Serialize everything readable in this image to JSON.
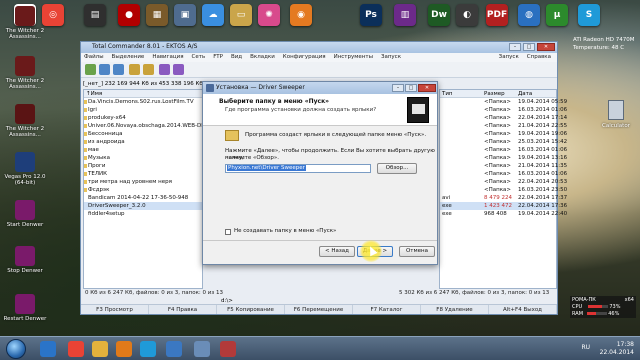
{
  "dock": {
    "icons": [
      {
        "name": "vlc-icon",
        "glyph": "▲",
        "color": "#ffffff"
      },
      {
        "name": "chrome-icon",
        "glyph": "◎",
        "color": "#e94335"
      },
      {
        "name": "film-icon",
        "glyph": "▤",
        "color": "#2f2f2f"
      },
      {
        "name": "record-icon",
        "glyph": "●",
        "color": "#b20000"
      },
      {
        "name": "archive-icon",
        "glyph": "▦",
        "color": "#7a5a2a"
      },
      {
        "name": "photos-icon",
        "glyph": "▣",
        "color": "#4f6c8f"
      },
      {
        "name": "cloud-icon",
        "glyph": "☁",
        "color": "#3a8fe0"
      },
      {
        "name": "folder-icon",
        "glyph": "▭",
        "color": "#caa54a"
      },
      {
        "name": "color-wheel-icon",
        "glyph": "✺",
        "color": "#d84a8c"
      },
      {
        "name": "firefox-icon",
        "glyph": "◉",
        "color": "#e47a21"
      },
      {
        "name": "ps-icon",
        "glyph": "Ps",
        "color": "#0b2f5a"
      },
      {
        "name": "winrar-icon",
        "glyph": "▥",
        "color": "#6c2a8a"
      },
      {
        "name": "dw-icon",
        "glyph": "Dw",
        "color": "#1e5a24"
      },
      {
        "name": "player-icon",
        "glyph": "◐",
        "color": "#3b3b3b"
      },
      {
        "name": "pdf-icon",
        "glyph": "PDF",
        "color": "#b32020"
      },
      {
        "name": "globe-icon",
        "glyph": "◍",
        "color": "#2a70c0"
      },
      {
        "name": "torrent-icon",
        "glyph": "µ",
        "color": "#2c8a2c"
      },
      {
        "name": "skype-icon",
        "glyph": "S",
        "color": "#1f9ad8"
      }
    ]
  },
  "gpu_widget": {
    "line1": "ATI Radeon HD 7470M",
    "line2": "Temperature: 48 C"
  },
  "desktop_icons": [
    {
      "label": "The Witcher 2 Assassins...",
      "color": "#6a1a1a"
    },
    {
      "label": "The Witcher 2 Assassins...",
      "color": "#6a1a1a"
    },
    {
      "label": "The Witcher 2 Assassins...",
      "color": "#5a1414"
    },
    {
      "label": "Vegas Pro 12.0 (64-bit)",
      "color": "#1e3e7a"
    },
    {
      "label": "Start Denwer",
      "color": "#7a1a6a"
    },
    {
      "label": "Stop Denwer",
      "color": "#7a1a6a"
    },
    {
      "label": "Restart Denwer",
      "color": "#7a1a6a"
    }
  ],
  "calculator": {
    "label": "Calculator"
  },
  "tc": {
    "title": "Total Commander 8.01 - EKTOS A/S",
    "menu": [
      "Файлы",
      "Выделение",
      "Навигация",
      "Сеть",
      "FTP",
      "Вид",
      "Вкладки",
      "Конфигурация",
      "Инструменты",
      "Запуск"
    ],
    "menu_right": [
      "Запуск",
      "Справка"
    ],
    "left_drive": "[_нет_]  232 169 944 Кб из 453 338 196 Кб",
    "left_path": "c:\\Users\\Documents\\*.*",
    "left_header": "↑Имя",
    "left_rows": [
      {
        "text": "Da.Vincis.Demons.S02.rus.LostFilm.TV",
        "dir": true
      },
      {
        "text": "Igri",
        "dir": true
      },
      {
        "text": "produkey-x64",
        "dir": true
      },
      {
        "text": "Univer.06.Novaya.obschaga.2014.WEB-DL.(720p",
        "dir": true
      },
      {
        "text": "Бессонница",
        "dir": true
      },
      {
        "text": "из андроида",
        "dir": true
      },
      {
        "text": "мае",
        "dir": true
      },
      {
        "text": "Музыка",
        "dir": true
      },
      {
        "text": "Проги",
        "dir": true
      },
      {
        "text": "ТЕЛИК",
        "dir": true
      },
      {
        "text": "три метра над уровнем неря",
        "dir": true
      },
      {
        "text": "Фсдрэк",
        "dir": true
      },
      {
        "text": "Bandicam 2014-04-22 17-36-50-948",
        "dir": false
      },
      {
        "text": "DriverSweeper_3.2.0",
        "dir": false
      },
      {
        "text": "fiddler4setup",
        "dir": false
      }
    ],
    "right_header": {
      "type": "Тип",
      "size": "Размер",
      "date": "Дата"
    },
    "right_rows": [
      {
        "name": "",
        "type": "",
        "size": "<Папка>",
        "date": "19.04.2014 05:59"
      },
      {
        "name": "",
        "type": "",
        "size": "<Папка>",
        "date": "16.03.2014 01:06"
      },
      {
        "name": "",
        "type": "",
        "size": "<Папка>",
        "date": "22.04.2014 17:14"
      },
      {
        "name": "MediaClub",
        "type": "",
        "size": "<Папка>",
        "date": "21.04.2014 22:55"
      },
      {
        "name": "",
        "type": "",
        "size": "<Папка>",
        "date": "19.04.2014 19:06"
      },
      {
        "name": "",
        "type": "",
        "size": "<Папка>",
        "date": "25.03.2014 15:42"
      },
      {
        "name": "",
        "type": "",
        "size": "<Папка>",
        "date": "16.03.2014 01:06"
      },
      {
        "name": "",
        "type": "",
        "size": "<Папка>",
        "date": "19.04.2014 13:16"
      },
      {
        "name": "",
        "type": "",
        "size": "<Папка>",
        "date": "21.04.2014 11:35"
      },
      {
        "name": "",
        "type": "",
        "size": "<Папка>",
        "date": "16.03.2014 01:06"
      },
      {
        "name": "",
        "type": "",
        "size": "<Папка>",
        "date": "22.04.2014 20:53"
      },
      {
        "name": "",
        "type": "",
        "size": "<Папка>",
        "date": "16.03.2014 23:50"
      },
      {
        "name": "",
        "type": "avi",
        "size": "8 479 224",
        "date": "22.04.2014 17:37"
      },
      {
        "name": "",
        "type": "exe",
        "size": "1 423 472",
        "date": "22.04.2014 17:36"
      },
      {
        "name": "",
        "type": "exe",
        "size": "968 408",
        "date": "19.04.2014 22:40"
      }
    ],
    "left_status": "0 Кб из 6 247 Кб, файлов: 0 из 3, папок: 0 из 13",
    "right_status": "5 302 Кб из 6 247 Кб, файлов: 0 из 3, папок: 0 из 13",
    "cmd_prompt": "d:\\>",
    "fkeys": [
      "F3 Просмотр",
      "F4 Правка",
      "F5 Копирование",
      "F6 Перемещение",
      "F7 Каталог",
      "F8 Удаление",
      "Alt+F4 Выход"
    ]
  },
  "dialog": {
    "title": "Установка — Driver Sweeper",
    "heading": "Выберите папку в меню «Пуск»",
    "subheading": "Где программа установки должна создать ярлыки?",
    "info": "Программа создаст ярлыки в следующей папке меню «Пуск».",
    "instruction_line1": "Нажмите «Далее», чтобы продолжить. Если Вы хотите выбрать другую папку,",
    "instruction_line2": "нажмите «Обзор».",
    "folder_value": "Phyxion.net\\Driver Sweeper",
    "browse_label": "Обзор...",
    "checkbox_label": "Не создавать папку в меню «Пуск»",
    "back_label": "< Назад",
    "next_label": "Далее >",
    "cancel_label": "Отмена"
  },
  "cpu_widget": {
    "title": "РОМА-ПК",
    "arch": "x64",
    "cpu_label": "CPU",
    "cpu_value": "73%",
    "cpu_level": 0.73,
    "ram_label": "RAM",
    "ram_value": "46%",
    "ram_level": 0.46
  },
  "taskbar": {
    "lang": "RU",
    "time": "17:38",
    "date": "22.04.2014",
    "items": [
      {
        "name": "ie-icon",
        "color": "#2a74c8"
      },
      {
        "name": "chrome-taskbar-icon",
        "color": "#e94335"
      },
      {
        "name": "explorer-icon",
        "color": "#e3b23c"
      },
      {
        "name": "media-icon",
        "color": "#e07a1a"
      },
      {
        "name": "skype-taskbar-icon",
        "color": "#1f9ad8"
      },
      {
        "name": "totalcmd-taskbar-icon",
        "color": "#3b78c2"
      },
      {
        "name": "setup-taskbar-icon",
        "color": "#6a8db8"
      },
      {
        "name": "bandicam-taskbar-icon",
        "color": "#b23a3a"
      }
    ]
  }
}
